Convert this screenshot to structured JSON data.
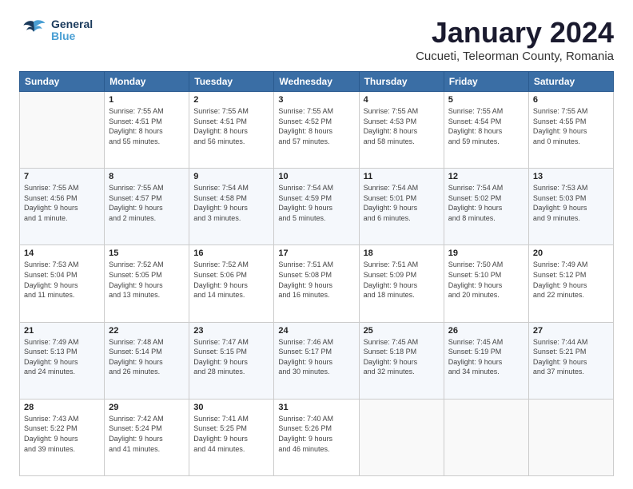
{
  "header": {
    "logo_general": "General",
    "logo_blue": "Blue",
    "title": "January 2024",
    "subtitle": "Cucueti, Teleorman County, Romania"
  },
  "weekdays": [
    "Sunday",
    "Monday",
    "Tuesday",
    "Wednesday",
    "Thursday",
    "Friday",
    "Saturday"
  ],
  "weeks": [
    [
      {
        "num": "",
        "info": ""
      },
      {
        "num": "1",
        "info": "Sunrise: 7:55 AM\nSunset: 4:51 PM\nDaylight: 8 hours\nand 55 minutes."
      },
      {
        "num": "2",
        "info": "Sunrise: 7:55 AM\nSunset: 4:51 PM\nDaylight: 8 hours\nand 56 minutes."
      },
      {
        "num": "3",
        "info": "Sunrise: 7:55 AM\nSunset: 4:52 PM\nDaylight: 8 hours\nand 57 minutes."
      },
      {
        "num": "4",
        "info": "Sunrise: 7:55 AM\nSunset: 4:53 PM\nDaylight: 8 hours\nand 58 minutes."
      },
      {
        "num": "5",
        "info": "Sunrise: 7:55 AM\nSunset: 4:54 PM\nDaylight: 8 hours\nand 59 minutes."
      },
      {
        "num": "6",
        "info": "Sunrise: 7:55 AM\nSunset: 4:55 PM\nDaylight: 9 hours\nand 0 minutes."
      }
    ],
    [
      {
        "num": "7",
        "info": "Sunrise: 7:55 AM\nSunset: 4:56 PM\nDaylight: 9 hours\nand 1 minute."
      },
      {
        "num": "8",
        "info": "Sunrise: 7:55 AM\nSunset: 4:57 PM\nDaylight: 9 hours\nand 2 minutes."
      },
      {
        "num": "9",
        "info": "Sunrise: 7:54 AM\nSunset: 4:58 PM\nDaylight: 9 hours\nand 3 minutes."
      },
      {
        "num": "10",
        "info": "Sunrise: 7:54 AM\nSunset: 4:59 PM\nDaylight: 9 hours\nand 5 minutes."
      },
      {
        "num": "11",
        "info": "Sunrise: 7:54 AM\nSunset: 5:01 PM\nDaylight: 9 hours\nand 6 minutes."
      },
      {
        "num": "12",
        "info": "Sunrise: 7:54 AM\nSunset: 5:02 PM\nDaylight: 9 hours\nand 8 minutes."
      },
      {
        "num": "13",
        "info": "Sunrise: 7:53 AM\nSunset: 5:03 PM\nDaylight: 9 hours\nand 9 minutes."
      }
    ],
    [
      {
        "num": "14",
        "info": "Sunrise: 7:53 AM\nSunset: 5:04 PM\nDaylight: 9 hours\nand 11 minutes."
      },
      {
        "num": "15",
        "info": "Sunrise: 7:52 AM\nSunset: 5:05 PM\nDaylight: 9 hours\nand 13 minutes."
      },
      {
        "num": "16",
        "info": "Sunrise: 7:52 AM\nSunset: 5:06 PM\nDaylight: 9 hours\nand 14 minutes."
      },
      {
        "num": "17",
        "info": "Sunrise: 7:51 AM\nSunset: 5:08 PM\nDaylight: 9 hours\nand 16 minutes."
      },
      {
        "num": "18",
        "info": "Sunrise: 7:51 AM\nSunset: 5:09 PM\nDaylight: 9 hours\nand 18 minutes."
      },
      {
        "num": "19",
        "info": "Sunrise: 7:50 AM\nSunset: 5:10 PM\nDaylight: 9 hours\nand 20 minutes."
      },
      {
        "num": "20",
        "info": "Sunrise: 7:49 AM\nSunset: 5:12 PM\nDaylight: 9 hours\nand 22 minutes."
      }
    ],
    [
      {
        "num": "21",
        "info": "Sunrise: 7:49 AM\nSunset: 5:13 PM\nDaylight: 9 hours\nand 24 minutes."
      },
      {
        "num": "22",
        "info": "Sunrise: 7:48 AM\nSunset: 5:14 PM\nDaylight: 9 hours\nand 26 minutes."
      },
      {
        "num": "23",
        "info": "Sunrise: 7:47 AM\nSunset: 5:15 PM\nDaylight: 9 hours\nand 28 minutes."
      },
      {
        "num": "24",
        "info": "Sunrise: 7:46 AM\nSunset: 5:17 PM\nDaylight: 9 hours\nand 30 minutes."
      },
      {
        "num": "25",
        "info": "Sunrise: 7:45 AM\nSunset: 5:18 PM\nDaylight: 9 hours\nand 32 minutes."
      },
      {
        "num": "26",
        "info": "Sunrise: 7:45 AM\nSunset: 5:19 PM\nDaylight: 9 hours\nand 34 minutes."
      },
      {
        "num": "27",
        "info": "Sunrise: 7:44 AM\nSunset: 5:21 PM\nDaylight: 9 hours\nand 37 minutes."
      }
    ],
    [
      {
        "num": "28",
        "info": "Sunrise: 7:43 AM\nSunset: 5:22 PM\nDaylight: 9 hours\nand 39 minutes."
      },
      {
        "num": "29",
        "info": "Sunrise: 7:42 AM\nSunset: 5:24 PM\nDaylight: 9 hours\nand 41 minutes."
      },
      {
        "num": "30",
        "info": "Sunrise: 7:41 AM\nSunset: 5:25 PM\nDaylight: 9 hours\nand 44 minutes."
      },
      {
        "num": "31",
        "info": "Sunrise: 7:40 AM\nSunset: 5:26 PM\nDaylight: 9 hours\nand 46 minutes."
      },
      {
        "num": "",
        "info": ""
      },
      {
        "num": "",
        "info": ""
      },
      {
        "num": "",
        "info": ""
      }
    ]
  ]
}
